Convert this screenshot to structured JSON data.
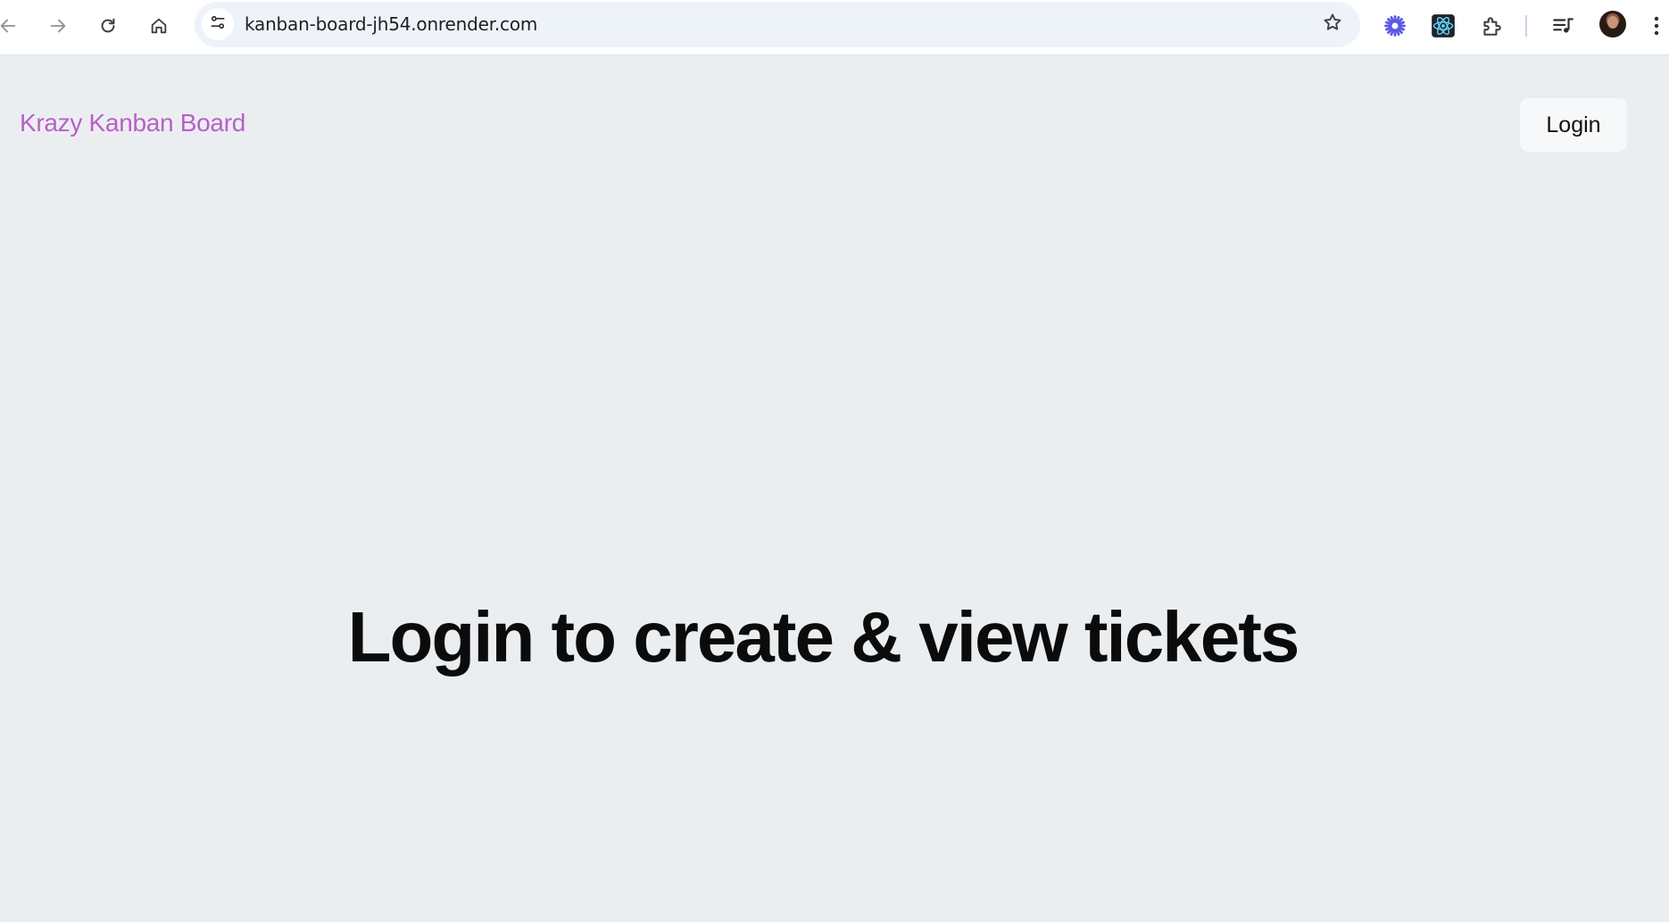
{
  "browser": {
    "url": "kanban-board-jh54.onrender.com",
    "icons": {
      "back": "arrow-left-icon",
      "forward": "arrow-right-icon",
      "reload": "reload-icon",
      "home": "home-icon",
      "site_info": "tune-icon",
      "bookmark": "star-icon",
      "extension_1": "asterisk-extension-icon",
      "extension_2": "react-devtools-icon",
      "extensions": "puzzle-icon",
      "media": "media-queue-icon",
      "profile": "avatar",
      "menu": "kebab-menu-icon"
    }
  },
  "header": {
    "brand": "Krazy Kanban Board",
    "login_label": "Login"
  },
  "main": {
    "headline": "Login to create & view tickets"
  },
  "colors": {
    "brand": "#b860c9",
    "page_background": "#ebeef0",
    "omnibox_background": "#eef2f9"
  }
}
